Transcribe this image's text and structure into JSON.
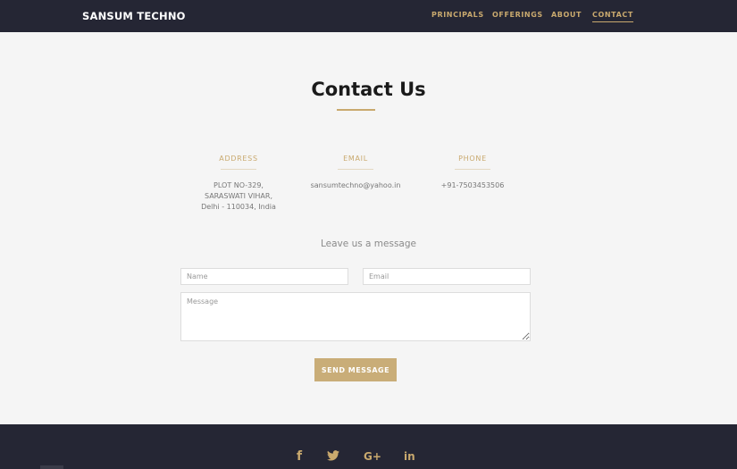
{
  "navbar": {
    "brand": "SANSUM TECHNO",
    "links": [
      {
        "label": "PRINCIPALS"
      },
      {
        "label": "OFFERINGS"
      },
      {
        "label": "ABOUT"
      },
      {
        "label": "CONTACT"
      }
    ],
    "active_link": "CONTACT"
  },
  "contact": {
    "title": "Contact Us",
    "address": {
      "heading": "ADDRESS",
      "line1": "PLOT NO-329,",
      "line2": "SARASWATI VIHAR,",
      "line3": "Delhi - 110034, India"
    },
    "email": {
      "heading": "EMAIL",
      "value": "sansumtechno@yahoo.in"
    },
    "phone": {
      "heading": "PHONE",
      "value": "+91-7503453506"
    }
  },
  "form": {
    "intro": "Leave us a message",
    "name_placeholder": "Name",
    "email_placeholder": "Email",
    "message_placeholder": "Message",
    "submit_label": "SEND MESSAGE"
  },
  "footer": {
    "social": [
      {
        "icon": "facebook-icon",
        "glyph": "f"
      },
      {
        "icon": "twitter-icon",
        "glyph": "🐦"
      },
      {
        "icon": "google-plus-icon",
        "glyph": "G+"
      },
      {
        "icon": "linkedin-icon",
        "glyph": "in"
      }
    ]
  },
  "colors": {
    "nav_bg": "#252634",
    "accent": "#c9a96e",
    "page_bg": "#f5f5f5",
    "button_bg": "#c9ad78"
  }
}
